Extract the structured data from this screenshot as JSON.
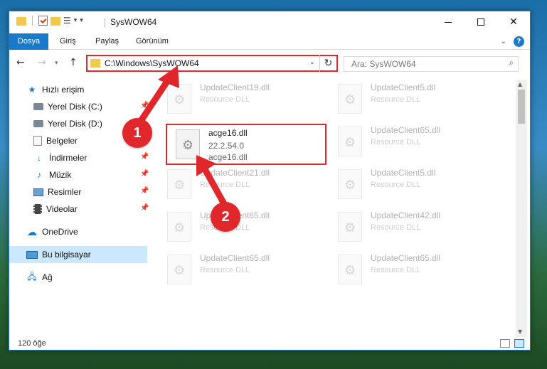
{
  "window": {
    "title": "SysWOW64"
  },
  "ribbon": {
    "tabs": [
      {
        "label": "Dosya"
      },
      {
        "label": "Giriş"
      },
      {
        "label": "Paylaş"
      },
      {
        "label": "Görünüm"
      }
    ]
  },
  "address_bar": {
    "path": "C:\\Windows\\SysWOW64"
  },
  "search": {
    "placeholder": "Ara: SysWOW64"
  },
  "sidebar": {
    "items": [
      {
        "label": "Hızlı erişim",
        "icon": "star-icon"
      },
      {
        "label": "Yerel Disk (C:)",
        "icon": "disk-icon",
        "pinned": true
      },
      {
        "label": "Yerel Disk (D:)",
        "icon": "disk-icon"
      },
      {
        "label": "Belgeler",
        "icon": "documents-icon",
        "pinned": true
      },
      {
        "label": "İndirmeler",
        "icon": "downloads-icon",
        "pinned": true
      },
      {
        "label": "Müzik",
        "icon": "music-icon",
        "pinned": true
      },
      {
        "label": "Resimler",
        "icon": "pictures-icon",
        "pinned": true
      },
      {
        "label": "Videolar",
        "icon": "videos-icon",
        "pinned": true
      },
      {
        "label": "OneDrive",
        "icon": "onedrive-icon"
      },
      {
        "label": "Bu bilgisayar",
        "icon": "computer-icon",
        "selected": true
      },
      {
        "label": "Ağ",
        "icon": "network-icon"
      }
    ]
  },
  "files": {
    "left": [
      {
        "name": "UpdateClient19.dll",
        "desc": "Resource DLL"
      },
      {
        "name": "acge16.dll",
        "version": "22.2.54.0",
        "desc": "acge16.dll"
      },
      {
        "name": "UpdateClient21.dll",
        "desc": "Resource DLL"
      },
      {
        "name": "UpdateClient65.dll",
        "desc": "Resource DLL"
      },
      {
        "name": "UpdateClient65.dll",
        "desc": "Resource DLL"
      }
    ],
    "right": [
      {
        "name": "UpdateClient5.dll",
        "desc": "Resource DLL"
      },
      {
        "name": "UpdateClient65.dll",
        "desc": "Resource DLL"
      },
      {
        "name": "UpdateClient5.dll",
        "desc": "Resource DLL"
      },
      {
        "name": "UpdateClient42.dll",
        "desc": "Resource DLL"
      },
      {
        "name": "UpdateClient65.dll",
        "desc": "Resource DLL"
      }
    ]
  },
  "status": {
    "count": "120 öğe"
  },
  "markers": [
    {
      "label": "1"
    },
    {
      "label": "2"
    }
  ],
  "colors": {
    "accent": "#1979ca",
    "highlight": "#e0272b",
    "selected": "#cce8ff"
  }
}
